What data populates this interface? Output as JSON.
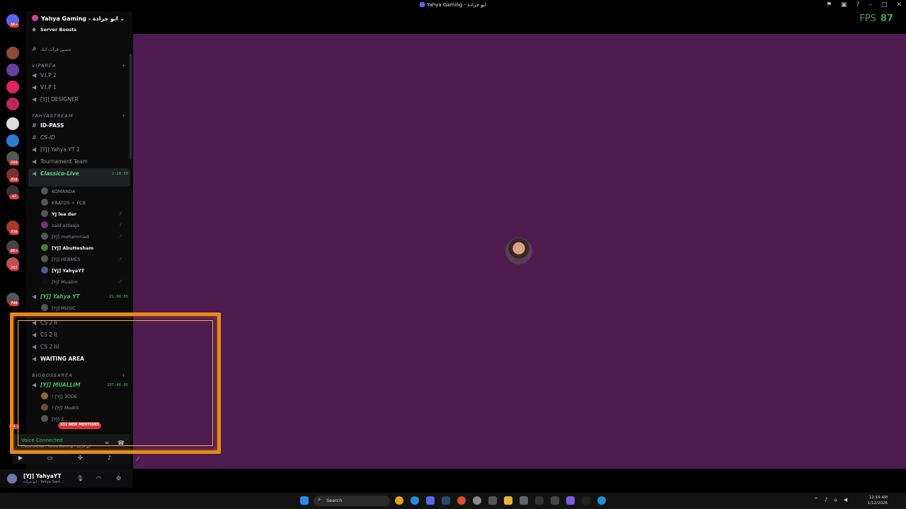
{
  "window": {
    "title": "Yahya Gaming - ابو جرادة",
    "fps_label": "FPS",
    "fps_value": "87"
  },
  "server": {
    "name": "Yahya Gaming - ابو جرادة",
    "boosts": "Server Boosts"
  },
  "rail_badges": [
    "5K+",
    "234",
    "214",
    "17",
    "710",
    "2K+",
    "717",
    "709",
    "4"
  ],
  "channels": {
    "top_text": "شمس-قرأت-كبك",
    "cat_vip": "VIPAREA",
    "vip2": "V.I.P 2",
    "vip1": "V.I.P 1",
    "designer": "[YJ] DESIGNER",
    "cat_stream": "YAHYASTREAM",
    "idpass": "ID-PASS",
    "cs_id": "CS-ID",
    "yt2": "[YJ] Yahya YT 2",
    "tournament": "Tournament Team",
    "classico": "Classico-Live",
    "classico_time": "2:28:50",
    "yahya_yt": "[YJ] Yahya YT",
    "yahya_yt_time": "21:00:05",
    "music": "[YJ] MUSIC",
    "cs2_a": "CS 2 II",
    "cs2_b": "CS 2 II",
    "cs2_c": "CS 2 III",
    "waiting": "WAITING AREA",
    "cat_boss": "BIGBOSSAREA",
    "muallim": "[YJ] MUALLIM",
    "muallim_time": "107:46:05"
  },
  "voice_users_classico": [
    "KOMANDA",
    "KRATOS ✧ FCB",
    "YJ lea der",
    "zaid aldaaja",
    "[YJ] mohammad",
    "[YJ] AbuHesham",
    "[YJ] HERMES",
    "[YJ] YahyaYT",
    "[YJ] Mualim"
  ],
  "voice_users_muallim": [
    "! [YJ] 3ODE",
    "! [YJ] Modric",
    "[YJ] Z..."
  ],
  "mentions": "832 NEW MENTIONS",
  "voice": {
    "title": "Voice Connected",
    "subtitle": "Classico-Live / Yahya Gaming - ابو جرادة"
  },
  "user": {
    "name": "[YJ] YahyaYT",
    "status": "ابو جرادة - Yahya Gam..."
  },
  "taskbar": {
    "search_label": "Search",
    "time": "12:19 AM",
    "date": "1/12/2026"
  },
  "colors": {
    "stage": "#4e1c4f",
    "overlay_frame": "#e58a17",
    "voice_green": "#3fbf5f",
    "mention_red": "#d93636"
  }
}
